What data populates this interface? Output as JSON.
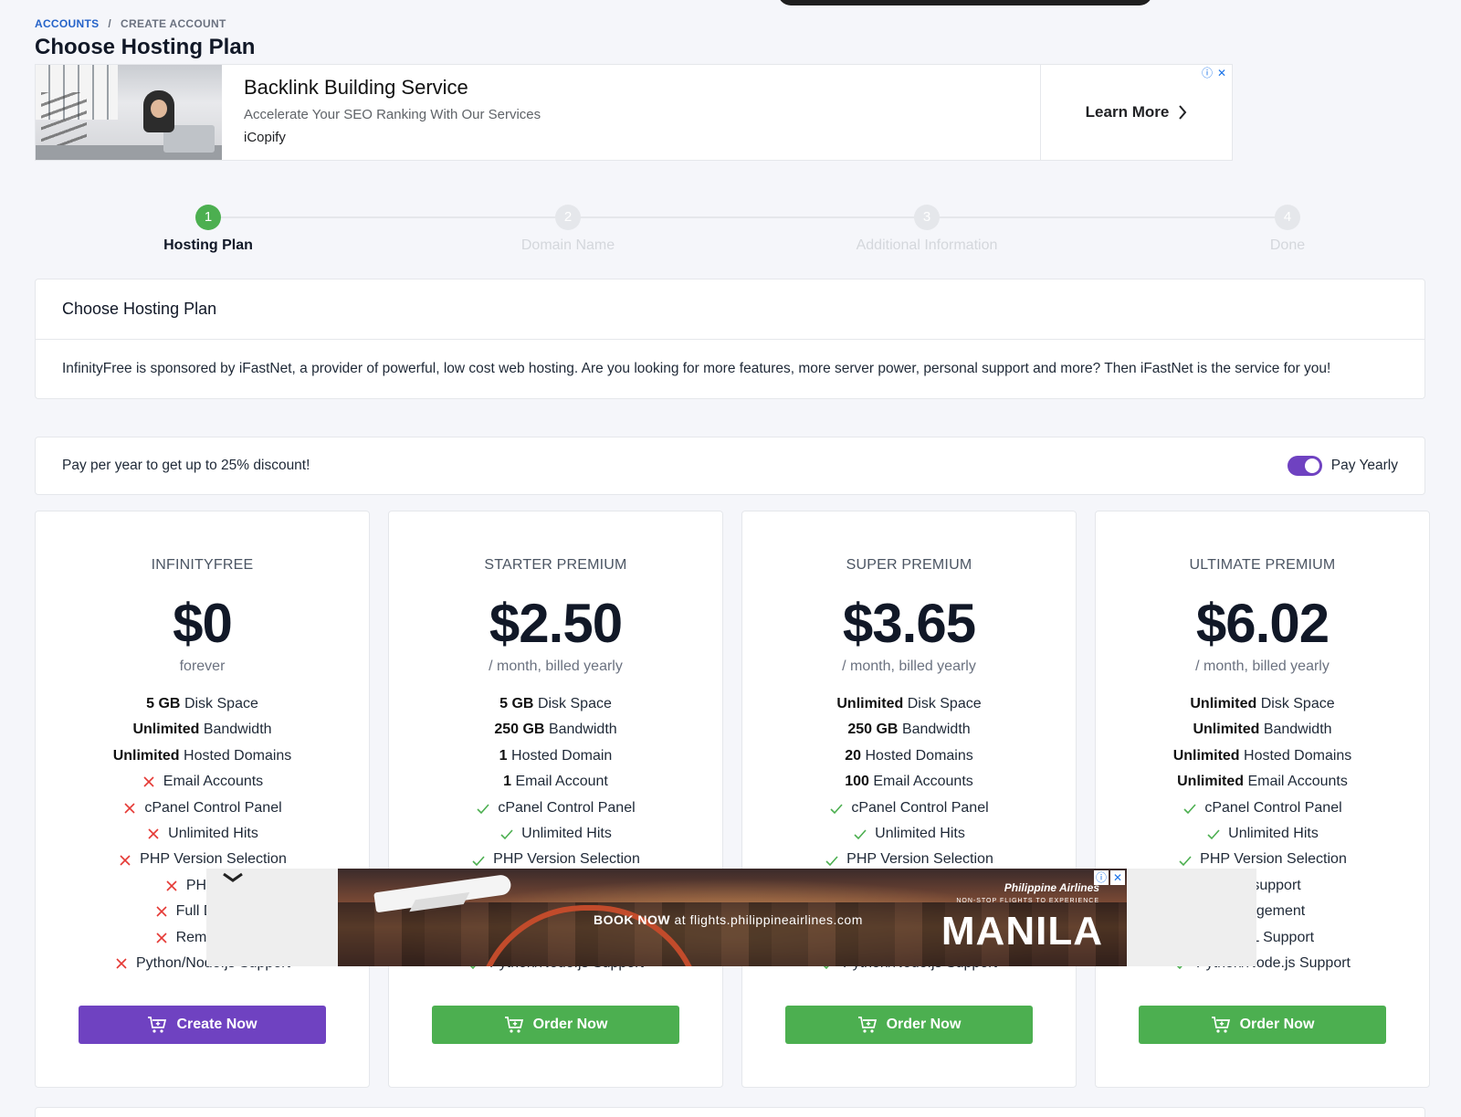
{
  "breadcrumb": {
    "accounts": "ACCOUNTS",
    "separator": "/",
    "current": "CREATE ACCOUNT"
  },
  "page_title": "Choose Hosting Plan",
  "ad_banner": {
    "title": "Backlink Building Service",
    "subtitle": "Accelerate Your SEO Ranking With Our Services",
    "brand": "iCopify",
    "cta": "Learn More",
    "info_icon": "ⓘ",
    "close_icon": "✕"
  },
  "stepper": {
    "steps": [
      {
        "number": "1",
        "label": "Hosting Plan",
        "active": true
      },
      {
        "number": "2",
        "label": "Domain Name",
        "active": false
      },
      {
        "number": "3",
        "label": "Additional Information",
        "active": false
      },
      {
        "number": "4",
        "label": "Done",
        "active": false
      }
    ]
  },
  "intro_card": {
    "header": "Choose Hosting Plan",
    "body": "InfinityFree is sponsored by iFastNet, a provider of powerful, low cost web hosting. Are you looking for more features, more server power, personal support and more? Then iFastNet is the service for you!"
  },
  "discount_card": {
    "text": "Pay per year to get up to 25% discount!",
    "toggle_label": "Pay Yearly",
    "toggle_on": true
  },
  "colors": {
    "purple": "#6f42c1",
    "green": "#4caf50",
    "red_x": "#e53935",
    "link_blue": "#2563c9"
  },
  "plans": [
    {
      "name": "INFINITYFREE",
      "price": "$0",
      "period": "forever",
      "button": "Create Now",
      "button_style": "purple",
      "features": [
        {
          "bold": "5 GB",
          "text": "Disk Space",
          "mark": "none"
        },
        {
          "bold": "Unlimited",
          "text": "Bandwidth",
          "mark": "none"
        },
        {
          "bold": "Unlimited",
          "text": "Hosted Domains",
          "mark": "none"
        },
        {
          "bold": "",
          "text": "Email Accounts",
          "mark": "x"
        },
        {
          "bold": "",
          "text": "cPanel Control Panel",
          "mark": "x"
        },
        {
          "bold": "",
          "text": "Unlimited Hits",
          "mark": "x"
        },
        {
          "bold": "",
          "text": "PHP Version Selection",
          "mark": "x"
        },
        {
          "bold": "",
          "text": "PHP ma",
          "mark": "x"
        },
        {
          "bold": "",
          "text": "Full DNS M",
          "mark": "x"
        },
        {
          "bold": "",
          "text": "Remote My",
          "mark": "x"
        },
        {
          "bold": "",
          "text": "Python/Node.js Support",
          "mark": "x"
        }
      ]
    },
    {
      "name": "STARTER PREMIUM",
      "price": "$2.50",
      "period": "/ month, billed yearly",
      "button": "Order Now",
      "button_style": "green",
      "features": [
        {
          "bold": "5 GB",
          "text": "Disk Space",
          "mark": "none"
        },
        {
          "bold": "250 GB",
          "text": "Bandwidth",
          "mark": "none"
        },
        {
          "bold": "1",
          "text": "Hosted Domain",
          "mark": "none"
        },
        {
          "bold": "1",
          "text": "Email Account",
          "mark": "none"
        },
        {
          "bold": "",
          "text": "cPanel Control Panel",
          "mark": "check"
        },
        {
          "bold": "",
          "text": "Unlimited Hits",
          "mark": "check"
        },
        {
          "bold": "",
          "text": "PHP Version Selection",
          "mark": "check"
        },
        {
          "bold": "",
          "text": "",
          "mark": "none"
        },
        {
          "bold": "",
          "text": "",
          "mark": "none"
        },
        {
          "bold": "",
          "text": "",
          "mark": "none"
        },
        {
          "bold": "",
          "text": "Python/Node.js Support",
          "mark": "check"
        }
      ]
    },
    {
      "name": "SUPER PREMIUM",
      "price": "$3.65",
      "period": "/ month, billed yearly",
      "button": "Order Now",
      "button_style": "green",
      "features": [
        {
          "bold": "Unlimited",
          "text": "Disk Space",
          "mark": "none"
        },
        {
          "bold": "250 GB",
          "text": "Bandwidth",
          "mark": "none"
        },
        {
          "bold": "20",
          "text": "Hosted Domains",
          "mark": "none"
        },
        {
          "bold": "100",
          "text": "Email Accounts",
          "mark": "none"
        },
        {
          "bold": "",
          "text": "cPanel Control Panel",
          "mark": "check"
        },
        {
          "bold": "",
          "text": "Unlimited Hits",
          "mark": "check"
        },
        {
          "bold": "",
          "text": "PHP Version Selection",
          "mark": "check"
        },
        {
          "bold": "",
          "text": "",
          "mark": "none"
        },
        {
          "bold": "",
          "text": "",
          "mark": "none"
        },
        {
          "bold": "",
          "text": "",
          "mark": "none"
        },
        {
          "bold": "",
          "text": "Python/Node.js Support",
          "mark": "check"
        }
      ]
    },
    {
      "name": "ULTIMATE PREMIUM",
      "price": "$6.02",
      "period": "/ month, billed yearly",
      "button": "Order Now",
      "button_style": "green",
      "features": [
        {
          "bold": "Unlimited",
          "text": "Disk Space",
          "mark": "none"
        },
        {
          "bold": "Unlimited",
          "text": "Bandwidth",
          "mark": "none"
        },
        {
          "bold": "Unlimited",
          "text": "Hosted Domains",
          "mark": "none"
        },
        {
          "bold": "Unlimited",
          "text": "Email Accounts",
          "mark": "none"
        },
        {
          "bold": "",
          "text": "cPanel Control Panel",
          "mark": "check"
        },
        {
          "bold": "",
          "text": "Unlimited Hits",
          "mark": "check"
        },
        {
          "bold": "",
          "text": "PHP Version Selection",
          "mark": "check"
        },
        {
          "bold": "",
          "text": "ail() support",
          "mark": "none"
        },
        {
          "bold": "",
          "text": "Management",
          "mark": "none"
        },
        {
          "bold": "",
          "text": "MySQL Support",
          "mark": "none"
        },
        {
          "bold": "",
          "text": "Python/Node.js Support",
          "mark": "check"
        }
      ]
    }
  ],
  "overlay_ad": {
    "book_now": "BOOK NOW",
    "book_rest": "at flights.philippineairlines.com",
    "brand": "Philippine Airlines",
    "tagline": "NON-STOP FLIGHTS TO EXPERIENCE",
    "city": "MANILA",
    "info_icon": "ⓘ",
    "close_icon": "✕"
  }
}
